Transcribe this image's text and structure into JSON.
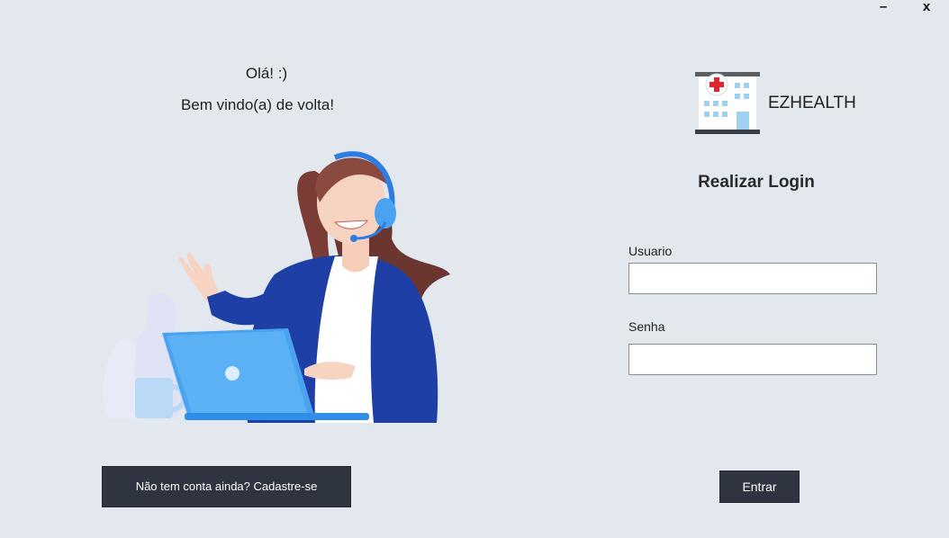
{
  "window": {
    "minimize_label": "–",
    "close_label": "x"
  },
  "greeting": {
    "line1": "Olá! :)",
    "line2": "Bem vindo(a) de volta!"
  },
  "brand": {
    "name": "EZHEALTH",
    "icon": "hospital-icon"
  },
  "login": {
    "title": "Realizar Login",
    "username_label": "Usuario",
    "username_value": "",
    "password_label": "Senha",
    "password_value": "",
    "submit_label": "Entrar"
  },
  "register": {
    "label": "Não tem conta ainda? Cadastre-se"
  },
  "colors": {
    "background": "#e3e7ee",
    "button_dark": "#2e3440",
    "hospital_red": "#e0262b",
    "illustration_blue": "#1f47a8",
    "laptop_blue": "#4aa3f0"
  }
}
